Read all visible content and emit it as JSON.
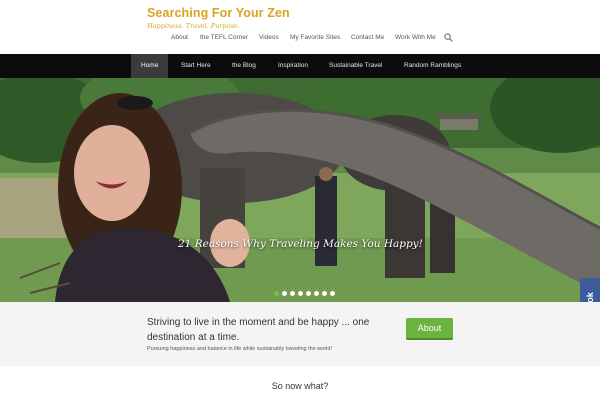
{
  "site": {
    "title": "Searching For Your Zen",
    "tagline": "Happiness. Travel. Purpose."
  },
  "topnav": {
    "items": [
      "About",
      "the TEFL Corner",
      "Videos",
      "My Favorite Sites",
      "Contact Me",
      "Work With Me"
    ],
    "search_icon": "magnifier"
  },
  "mainbar": {
    "items": [
      "Home",
      "Start Here",
      "the Blog",
      "Inspiration",
      "Sustainable Travel",
      "Random Ramblings"
    ],
    "active": "Home"
  },
  "hero": {
    "caption": "21 Reasons Why Traveling Makes You Happy!",
    "slide_count": 8,
    "active_slide": 1
  },
  "social": {
    "facebook_label": "facebook"
  },
  "featured": {
    "title": "Striving to live in the moment and be happy ... one destination at a time.",
    "subtitle": "Pursuing happiness and balance in life while sustainably traveling the world!",
    "button_label": "About"
  },
  "section": {
    "heading": "So now what?"
  },
  "colors": {
    "brand": "#d9a520",
    "menu_bg": "#0c0c0c",
    "button_green": "#6cb33f",
    "facebook_blue": "#3b5b99"
  }
}
